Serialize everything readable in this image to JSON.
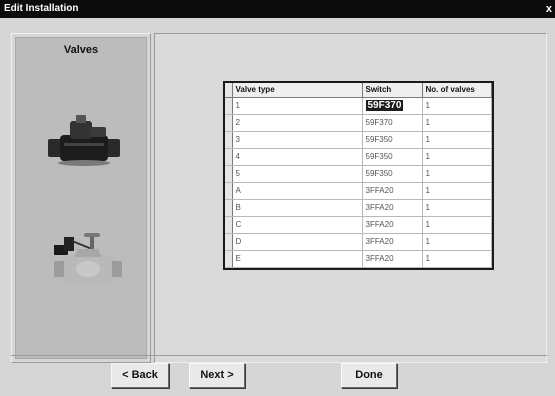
{
  "window": {
    "title": "Edit Installation",
    "close_glyph": "x"
  },
  "left_panel": {
    "title": "Valves"
  },
  "grid": {
    "columns": [
      "Valve type",
      "Switch",
      "No. of valves"
    ],
    "rows": [
      {
        "type": "1",
        "switch": "59F370",
        "count": "1"
      },
      {
        "type": "2",
        "switch": "59F370",
        "count": "1"
      },
      {
        "type": "3",
        "switch": "59F350",
        "count": "1"
      },
      {
        "type": "4",
        "switch": "59F350",
        "count": "1"
      },
      {
        "type": "5",
        "switch": "59F350",
        "count": "1"
      },
      {
        "type": "A",
        "switch": "3FFA20",
        "count": "1"
      },
      {
        "type": "B",
        "switch": "3FFA20",
        "count": "1"
      },
      {
        "type": "C",
        "switch": "3FFA20",
        "count": "1"
      },
      {
        "type": "D",
        "switch": "3FFA20",
        "count": "1"
      },
      {
        "type": "E",
        "switch": "3FFA20",
        "count": "1"
      }
    ]
  },
  "buttons": {
    "back": "< Back",
    "next": "Next >",
    "done": "Done"
  }
}
